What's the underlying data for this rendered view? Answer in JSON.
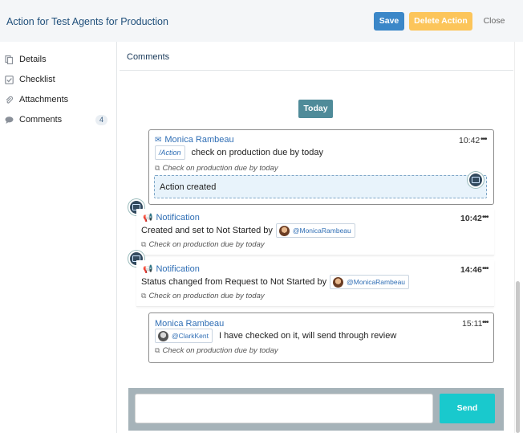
{
  "header": {
    "title": "Action for Test Agents for Production",
    "save_label": "Save",
    "delete_label": "Delete Action",
    "close_label": "Close"
  },
  "sidebar": {
    "items": [
      {
        "label": "Details",
        "icon": "document-icon"
      },
      {
        "label": "Checklist",
        "icon": "checkbox-icon"
      },
      {
        "label": "Attachments",
        "icon": "paperclip-icon"
      },
      {
        "label": "Comments",
        "icon": "chat-icon",
        "count": "4"
      }
    ]
  },
  "main": {
    "heading": "Comments",
    "day_label": "Today",
    "comments": [
      {
        "author": "Monica Rambeau",
        "time": "10:42",
        "tag": "/Action",
        "text": "check on production due by today",
        "reference": "Check on production due by today",
        "attached": "Action created"
      },
      {
        "author": "Notification",
        "time": "10:42",
        "text": "Created and set to Not Started by",
        "mention": "@MonicaRambeau",
        "reference": "Check on production due by today"
      },
      {
        "author": "Notification",
        "time": "14:46",
        "text": "Status changed from Request to Not Started by",
        "mention": "@MonicaRambeau",
        "reference": "Check on production due by today"
      },
      {
        "author": "Monica Rambeau",
        "time": "15:11",
        "mention": "@ClarkKent",
        "text": "I have checked on it, will send through review",
        "reference": "Check on production due by today"
      }
    ]
  },
  "composer": {
    "send_label": "Send"
  },
  "colors": {
    "save": "#3b87c8",
    "delete": "#fcc55a",
    "today": "#4f8b99",
    "send": "#19c9cd"
  }
}
